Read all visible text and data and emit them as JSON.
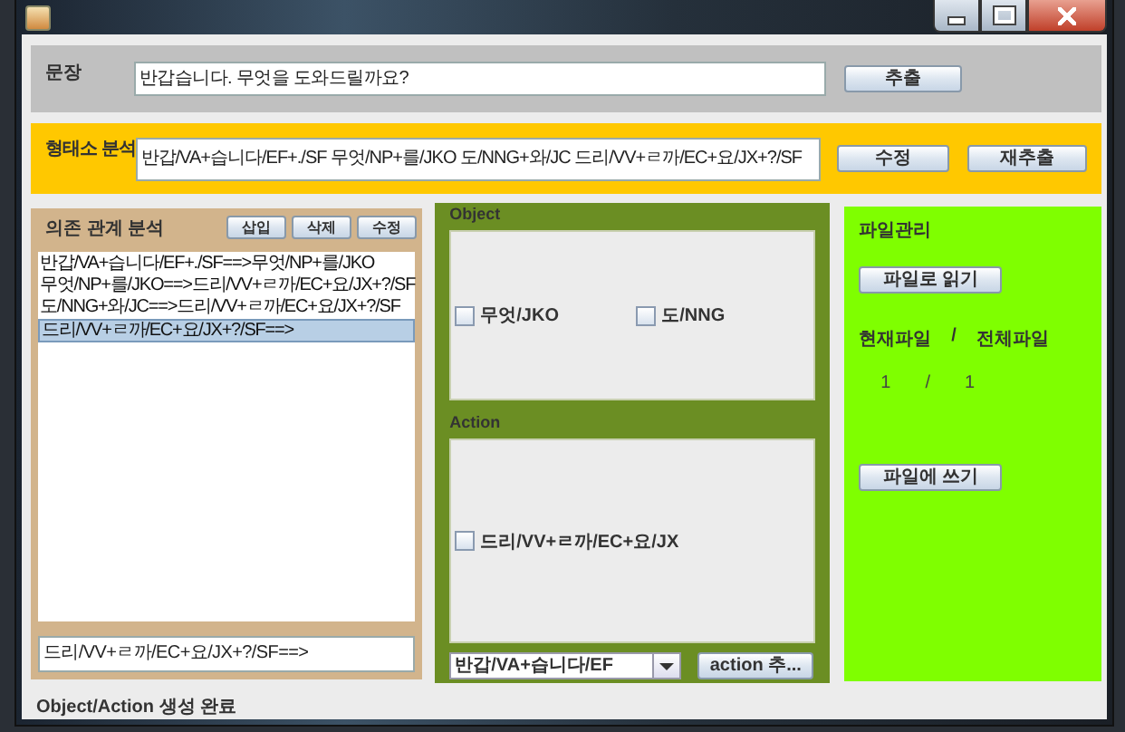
{
  "sentence": {
    "label": "문장",
    "value": "반갑습니다. 무엇을 도와드릴까요?",
    "button": "추출"
  },
  "morph": {
    "label": "형태소 분석",
    "value": "반갑/VA+습니다/EF+./SF 무엇/NP+를/JKO 도/NNG+와/JC 드리/VV+ㄹ까/EC+요/JX+?/SF",
    "buttons": [
      "수정",
      "재추출"
    ]
  },
  "dependency": {
    "title": "의존 관계 분석",
    "buttons": [
      "삽입",
      "삭제",
      "수정"
    ],
    "items": [
      {
        "text": "반갑/VA+습니다/EF+./SF==>무엇/NP+를/JKO",
        "selected": false
      },
      {
        "text": "무엇/NP+를/JKO==>드리/VV+ㄹ까/EC+요/JX+?/SF",
        "selected": false
      },
      {
        "text": "도/NNG+와/JC==>드리/VV+ㄹ까/EC+요/JX+?/SF",
        "selected": false
      },
      {
        "text": "드리/VV+ㄹ까/EC+요/JX+?/SF==>",
        "selected": true
      }
    ],
    "edit_value": "드리/VV+ㄹ까/EC+요/JX+?/SF==>"
  },
  "object": {
    "title": "Object",
    "items": [
      {
        "label": "무엇/JKO",
        "checked": false
      },
      {
        "label": "도/NNG",
        "checked": false
      }
    ]
  },
  "action": {
    "title": "Action",
    "items": [
      {
        "label": "드리/VV+ㄹ까/EC+요/JX",
        "checked": false
      }
    ],
    "combo_value": "반갑/VA+습니다/EF",
    "button": "action 추..."
  },
  "files": {
    "title": "파일관리",
    "read_button": "파일로 읽기",
    "header": [
      "현재파일",
      "/",
      "전체파일"
    ],
    "counter": [
      "1",
      "/",
      "1"
    ],
    "write_button": "파일에 쓰기"
  },
  "status_bar": "Object/Action 생성 완료"
}
